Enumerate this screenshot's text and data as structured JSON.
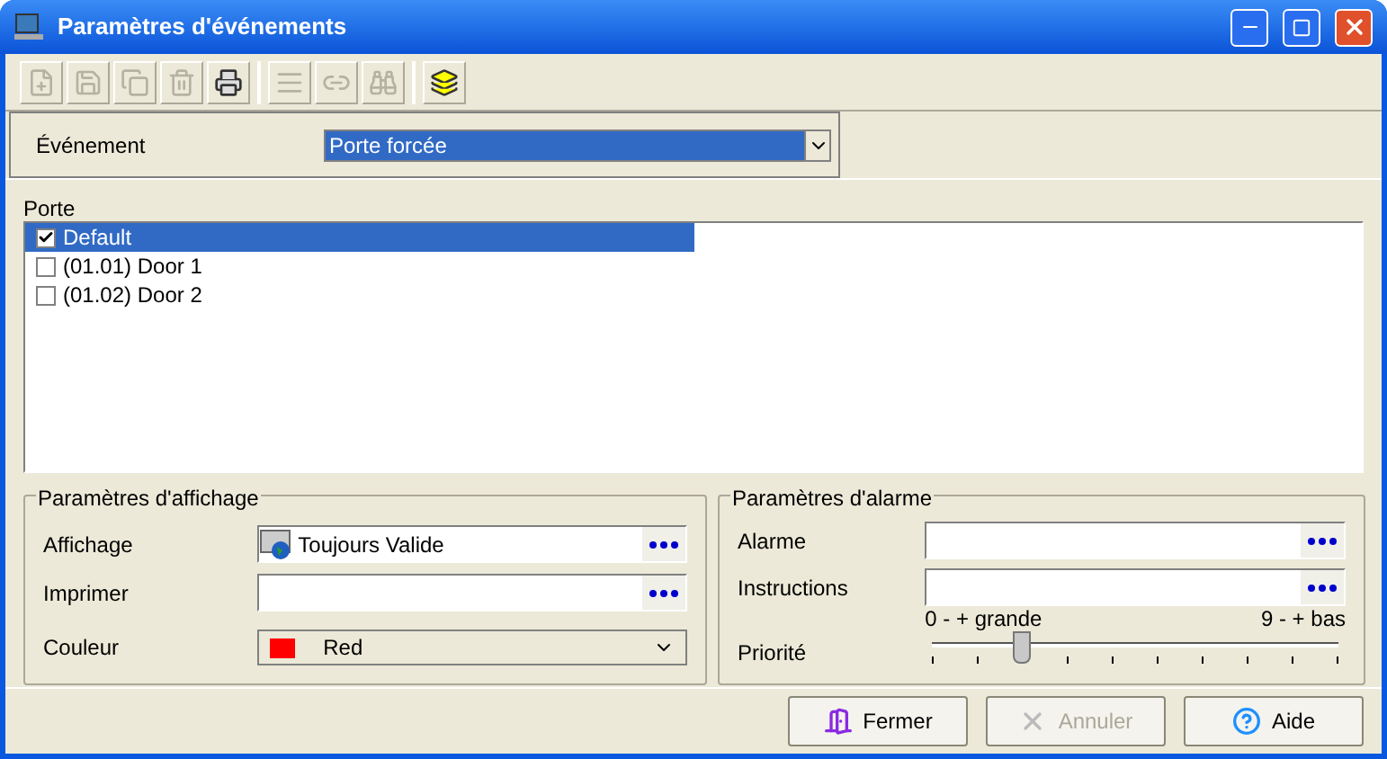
{
  "window": {
    "title": "Paramètres d'événements"
  },
  "toolbar": [
    {
      "kind": "new",
      "disabled": true
    },
    {
      "kind": "save",
      "disabled": true
    },
    {
      "kind": "copy",
      "disabled": true
    },
    {
      "kind": "delete",
      "disabled": true
    },
    {
      "kind": "print",
      "disabled": false
    },
    {
      "kind": "list",
      "disabled": true
    },
    {
      "kind": "link",
      "disabled": true
    },
    {
      "kind": "find",
      "disabled": true
    },
    {
      "kind": "windows",
      "disabled": false
    }
  ],
  "event": {
    "label": "Événement",
    "value": "Porte forcée"
  },
  "doors": {
    "label": "Porte",
    "items": [
      {
        "label": "Default",
        "checked": true,
        "selected": true
      },
      {
        "label": "(01.01) Door 1",
        "checked": false,
        "selected": false
      },
      {
        "label": "(01.02) Door 2",
        "checked": false,
        "selected": false
      }
    ]
  },
  "display": {
    "title": "Paramètres d'affichage",
    "affichage_label": "Affichage",
    "affichage_value": "Toujours Valide",
    "imprimer_label": "Imprimer",
    "couleur_label": "Couleur",
    "couleur": {
      "value": "Red",
      "color": "#ff0000"
    }
  },
  "alarm": {
    "title": "Paramètres d'alarme",
    "alarme_label": "Alarme",
    "instructions_label": "Instructions",
    "min_label": "0 - + grande",
    "max_label": "9 - + bas",
    "priority_label": "Priorité",
    "level": 0.22
  },
  "buttons": [
    {
      "kind": "close",
      "label": "Fermer",
      "disabled": false
    },
    {
      "kind": "cancel",
      "label": "Annuler",
      "disabled": true
    },
    {
      "kind": "help",
      "label": "Aide",
      "disabled": false
    }
  ]
}
